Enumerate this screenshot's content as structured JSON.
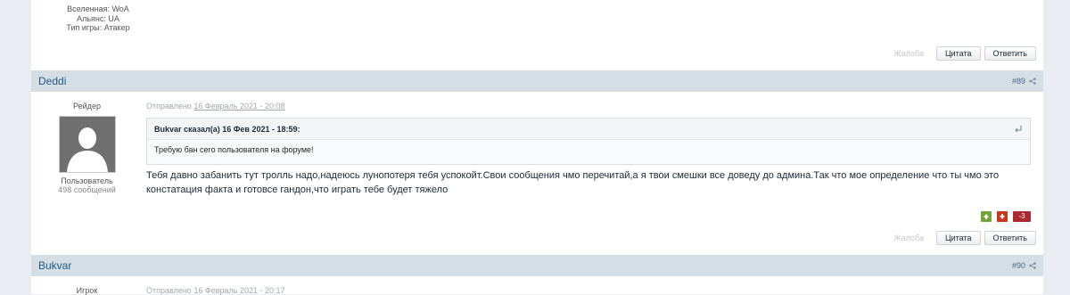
{
  "prev_post": {
    "info": [
      "Вселенная: WoA",
      "Альянс: UA",
      "Тип игры: Атакер"
    ],
    "report": "Жалоба",
    "quote_btn": "Цитата",
    "reply_btn": "Ответить"
  },
  "post89": {
    "author": "Deddi",
    "number": "#89",
    "rank": "Рейдер",
    "group": "Пользователь",
    "posts_count": "498 сообщений",
    "date_prefix": "Отправлено",
    "date": "16 Февраль 2021 - 20:08",
    "quote_author": "Bukvar сказал(а) 16 Фев 2021 - 18:59:",
    "quote_text": "Требую бан сего пользователя на форуме!",
    "text": "Тебя давно забанить тут тролль надо,надеюсь лунопотеря тебя успокойт.Свои сообщения чмо перечитай,а я твои смешки все доведу до админа.Так что мое определение что ты чмо это констатация факта и готовсе гандон,что играть тебе будет тяжело",
    "rep_count": "-3",
    "report": "Жалоба",
    "quote_btn": "Цитата",
    "reply_btn": "Ответить"
  },
  "post90": {
    "author": "Bukvar",
    "number": "#90",
    "rank": "Игрок",
    "date_prefix": "Отправлено",
    "date": "16 Февраль 2021 - 20:17"
  },
  "colors": {
    "header_bg": "#d5dde5",
    "author_link": "#225985",
    "rep_negative": "#ad2930",
    "rep_up": "#74a437",
    "rep_down": "#c8371c"
  }
}
